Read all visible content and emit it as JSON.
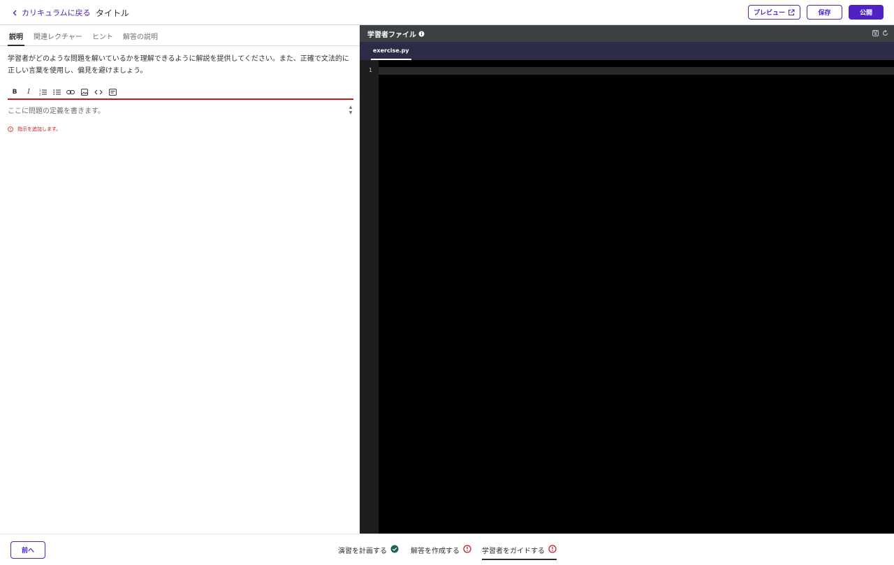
{
  "header": {
    "back_label": "カリキュラムに戻る",
    "title": "タイトル",
    "preview_label": "プレビュー",
    "save_label": "保存",
    "publish_label": "公開"
  },
  "left_panel": {
    "tabs": [
      {
        "label": "説明",
        "active": true
      },
      {
        "label": "関連レクチャー",
        "active": false
      },
      {
        "label": "ヒント",
        "active": false
      },
      {
        "label": "解答の説明",
        "active": false
      }
    ],
    "instructions": "学習者がどのような問題を解いているかを理解できるように解説を提供してください。また、正確で文法的に正しい言葉を使用し、偏見を避けましょう。",
    "toolbar_icons": [
      "bold-icon",
      "italic-icon",
      "ordered-list-icon",
      "bullet-list-icon",
      "link-icon",
      "image-icon",
      "code-icon",
      "code-block-icon"
    ],
    "editor_placeholder": "ここに問題の定義を書きます。",
    "error_message": "指示を追加します。"
  },
  "right_panel": {
    "title": "学習者ファイル",
    "file_tab": "exercise.py",
    "line_number": "1"
  },
  "footer": {
    "prev_label": "前へ",
    "steps": [
      {
        "label": "演習を計画する",
        "status": "complete"
      },
      {
        "label": "解答を作成する",
        "status": "error"
      },
      {
        "label": "学習者をガイドする",
        "status": "error",
        "active": true
      }
    ]
  },
  "colors": {
    "accent": "#5022c3",
    "error": "#c4161c",
    "success": "#1e6055",
    "editor_header": "#3e4143",
    "file_tab_bar": "#2c2b48"
  }
}
